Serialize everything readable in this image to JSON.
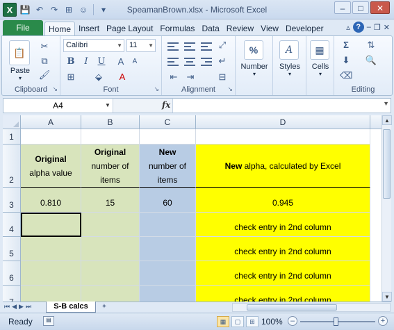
{
  "titlebar": {
    "app_icon": "X",
    "title": "SpeamanBrown.xlsx  -  Microsoft Excel"
  },
  "ribbon_tabs": {
    "file": "File",
    "tabs": [
      "Home",
      "Insert",
      "Page Layout",
      "Formulas",
      "Data",
      "Review",
      "View",
      "Developer"
    ],
    "active": "Home"
  },
  "ribbon": {
    "clipboard": {
      "label": "Clipboard",
      "paste": "Paste"
    },
    "font": {
      "label": "Font",
      "font_name": "Calibri",
      "font_size": "11",
      "bold": "B",
      "italic": "I",
      "underline": "U"
    },
    "alignment": {
      "label": "Alignment"
    },
    "number": {
      "label": "Number",
      "symbol": "%"
    },
    "styles": {
      "label": "Styles",
      "symbol": "A"
    },
    "cells": {
      "label": "Cells"
    },
    "editing": {
      "label": "Editing",
      "sigma": "Σ"
    }
  },
  "formula_bar": {
    "name_box": "A4",
    "fx": "fx",
    "content": ""
  },
  "grid": {
    "columns": [
      "A",
      "B",
      "C",
      "D"
    ],
    "rows": [
      "1",
      "2",
      "3",
      "4",
      "5",
      "6",
      "7"
    ],
    "header_row": {
      "a_bold": "Original",
      "a_rest": "alpha value",
      "b_bold": "Original",
      "b_rest1": "number of",
      "b_rest2": "items",
      "c_bold": "New",
      "c_rest1": "number of",
      "c_rest2": "items",
      "d_bold": "New",
      "d_rest": " alpha, calculated by Excel"
    },
    "row3": {
      "a": "0.810",
      "b": "15",
      "c": "60",
      "d": "0.945"
    },
    "check_text": "check entry in 2nd column"
  },
  "sheets": {
    "active": "S-B calcs"
  },
  "status": {
    "ready": "Ready",
    "zoom": "100%"
  },
  "colors": {
    "col_a": "#d8e4bc",
    "col_b": "#d8e4bc",
    "col_c": "#b8cce4",
    "col_d": "#ffff00",
    "file_tab": "#2a8a4a"
  }
}
